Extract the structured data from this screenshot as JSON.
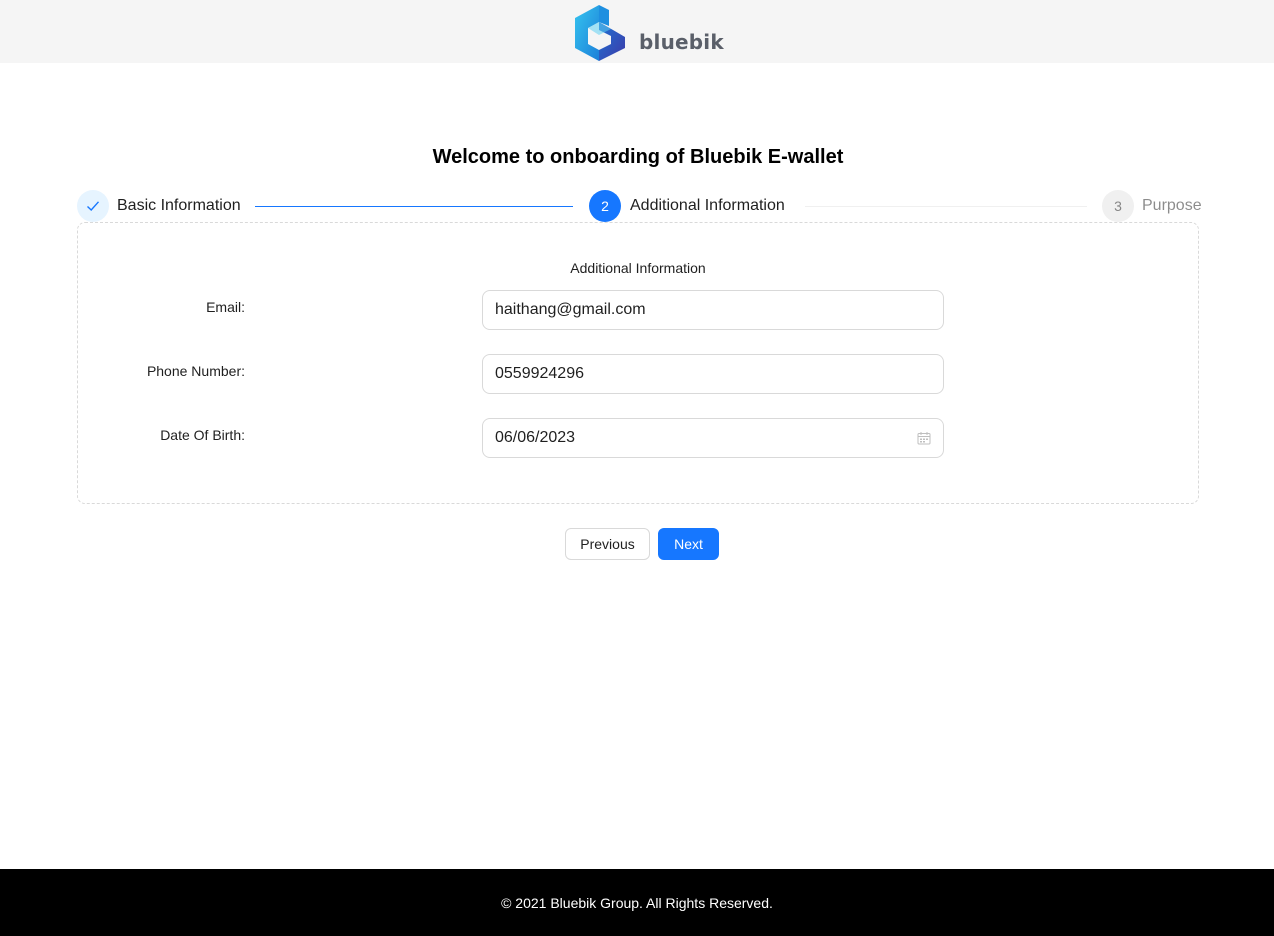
{
  "header": {
    "brand_name": "bluebik",
    "brand_colors": [
      "#2fb7e8",
      "#1f6fd6",
      "#3b3fae"
    ]
  },
  "page": {
    "title": "Welcome to onboarding of Bluebik E-wallet"
  },
  "steps": [
    {
      "number": "",
      "label": "Basic Information",
      "status": "finished",
      "icon": "check-icon"
    },
    {
      "number": "2",
      "label": "Additional Information",
      "status": "current"
    },
    {
      "number": "3",
      "label": "Purpose",
      "status": "waiting"
    }
  ],
  "form": {
    "section_title": "Additional Information",
    "fields": [
      {
        "label": "Email:",
        "value": "haithang@gmail.com"
      },
      {
        "label": "Phone Number:",
        "value": "0559924296"
      },
      {
        "label": "Date Of Birth:",
        "value": "06/06/2023",
        "icon": "calendar-icon"
      }
    ]
  },
  "buttons": {
    "previous": "Previous",
    "next": "Next"
  },
  "footer": {
    "copyright": "© 2021 Bluebik Group. All Rights Reserved."
  },
  "colors": {
    "primary": "#1677ff",
    "footer_bg": "#000000",
    "header_bg": "#f5f5f5"
  }
}
